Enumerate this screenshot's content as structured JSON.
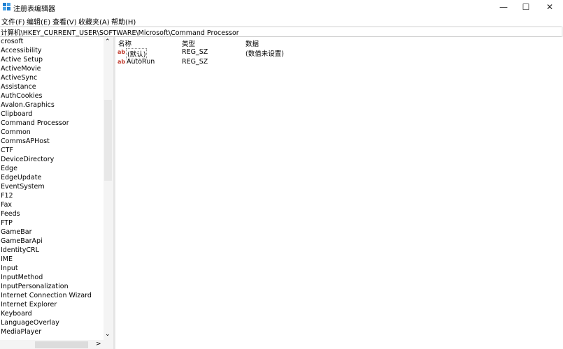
{
  "window": {
    "title": "注册表编辑器",
    "controls": {
      "minimize": "—",
      "maximize": "☐",
      "close": "✕"
    }
  },
  "menu": [
    "文件(F)",
    "编辑(E)",
    "查看(V)",
    "收藏夹(A)",
    "帮助(H)"
  ],
  "address": "计算机\\HKEY_CURRENT_USER\\SOFTWARE\\Microsoft\\Command Processor",
  "tree": {
    "items": [
      "crosoft",
      "Accessibility",
      "Active Setup",
      "ActiveMovie",
      "ActiveSync",
      "Assistance",
      "AuthCookies",
      "Avalon.Graphics",
      "Clipboard",
      "Command Processor",
      "Common",
      "CommsAPHost",
      "CTF",
      "DeviceDirectory",
      "Edge",
      "EdgeUpdate",
      "EventSystem",
      "F12",
      "Fax",
      "Feeds",
      "FTP",
      "GameBar",
      "GameBarApi",
      "IdentityCRL",
      "IME",
      "Input",
      "InputMethod",
      "InputPersonalization",
      "Internet Connection Wizard",
      "Internet Explorer",
      "Keyboard",
      "LanguageOverlay",
      "MediaPlayer"
    ]
  },
  "columns": {
    "name": "名称",
    "type": "类型",
    "data": "数据"
  },
  "values": [
    {
      "name": "(默认)",
      "type": "REG_SZ",
      "data": "(数值未设置)"
    },
    {
      "name": "AutoRun",
      "type": "REG_SZ",
      "data": ""
    }
  ]
}
